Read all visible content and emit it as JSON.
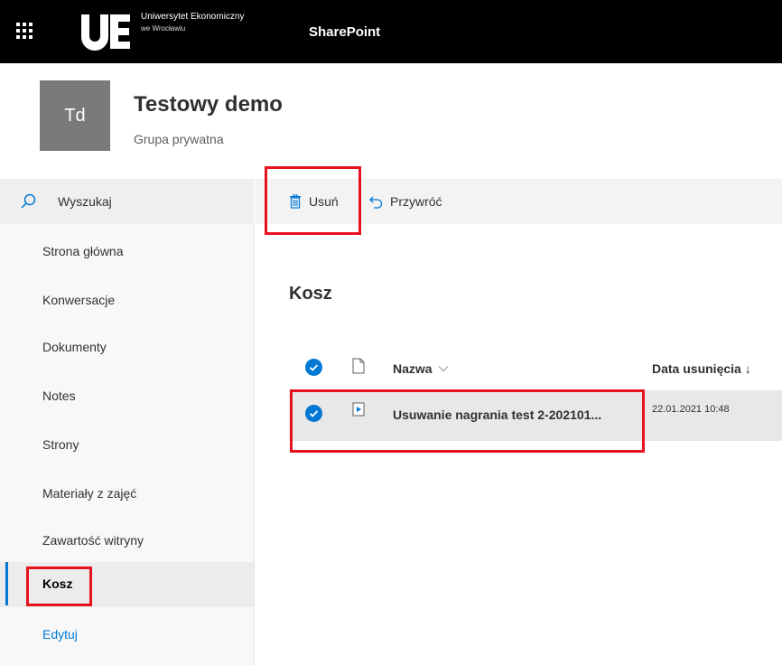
{
  "suite": {
    "app_launcher_icon": "waffle-icon",
    "logo_text": "UE",
    "university_line1": "Uniwersytet Ekonomiczny",
    "university_line2": "we Wrocławiu",
    "app_name": "SharePoint",
    "brand_color": "#000000"
  },
  "site": {
    "logo_initials": "Td",
    "title": "Testowy demo",
    "subtitle": "Grupa prywatna"
  },
  "leftnav": {
    "search_label": "Wyszukaj",
    "items": [
      {
        "label": "Strona główna"
      },
      {
        "label": "Konwersacje"
      },
      {
        "label": "Dokumenty"
      },
      {
        "label": "Notes"
      },
      {
        "label": "Strony"
      },
      {
        "label": "Materiały z zajęć"
      },
      {
        "label": "Zawartość witryny"
      },
      {
        "label": "Kosz",
        "active": true
      }
    ],
    "edit_label": "Edytuj",
    "accent_color": "#0078d4"
  },
  "commandbar": {
    "delete_label": "Usuń",
    "delete_icon": "trash-icon",
    "restore_label": "Przywróć",
    "restore_icon": "undo-icon"
  },
  "main": {
    "heading": "Kosz",
    "columns": {
      "name": "Nazwa",
      "deleted_date": "Data usunięcia ↓"
    },
    "rows": [
      {
        "name": "Usuwanie nagrania test 2-202101...",
        "deleted_date": "22.01.2021 10:48",
        "file_icon": "video-file-icon",
        "selected": true
      }
    ]
  },
  "highlight_color": "#e8121e"
}
